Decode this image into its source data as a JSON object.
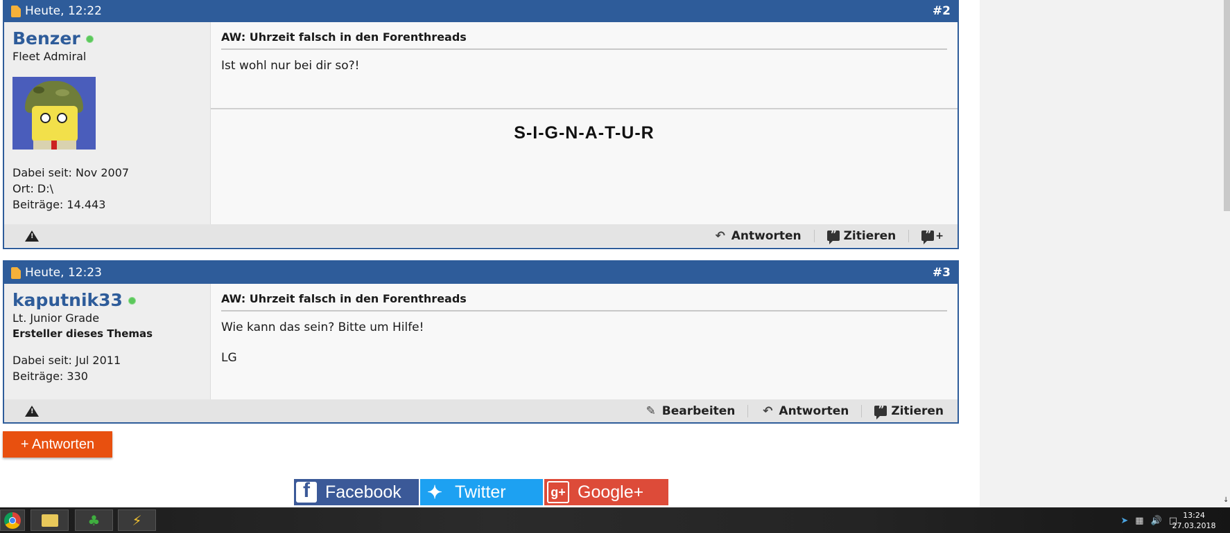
{
  "posts": [
    {
      "date": "Heute, 12:22",
      "number": "#2",
      "user": {
        "name": "Benzer",
        "rank": "Fleet Admiral",
        "joined": "Dabei seit: Nov 2007",
        "location": "Ort: D:\\",
        "posts": "Beiträge: 14.443"
      },
      "title": "AW: Uhrzeit falsch in den Forenthreads",
      "body": [
        "Ist wohl nur bei dir so?!"
      ],
      "signature": "S-I-G-N-A-T-U-R",
      "actions": {
        "reply": "Antworten",
        "quote": "Zitieren"
      }
    },
    {
      "date": "Heute, 12:23",
      "number": "#3",
      "user": {
        "name": "kaputnik33",
        "rank": "Lt. Junior Grade",
        "starter": "Ersteller dieses Themas",
        "joined": "Dabei seit: Jul 2011",
        "posts": "Beiträge: 330"
      },
      "title": "AW: Uhrzeit falsch in den Forenthreads",
      "body": [
        "Wie kann das sein? Bitte um Hilfe!",
        "LG"
      ],
      "actions": {
        "edit": "Bearbeiten",
        "reply": "Antworten",
        "quote": "Zitieren"
      }
    }
  ],
  "reply_button": "+ Antworten",
  "share": {
    "facebook": "Facebook",
    "twitter": "Twitter",
    "googleplus": "Google+"
  },
  "taskbar": {
    "time": "13:24",
    "date": "27.03.2018"
  },
  "colors": {
    "header": "#2e5c9a",
    "reply_button": "#e8500f",
    "facebook": "#3b5998",
    "twitter": "#1da1f2",
    "googleplus": "#dd4b39",
    "online": "#5cc85c"
  },
  "icons": [
    "post-date-icon",
    "online-status-icon",
    "warning-icon",
    "reply-arrow-icon",
    "quote-icon",
    "multiquote-icon",
    "edit-pencil-icon",
    "facebook-icon",
    "twitter-icon",
    "googleplus-icon"
  ]
}
